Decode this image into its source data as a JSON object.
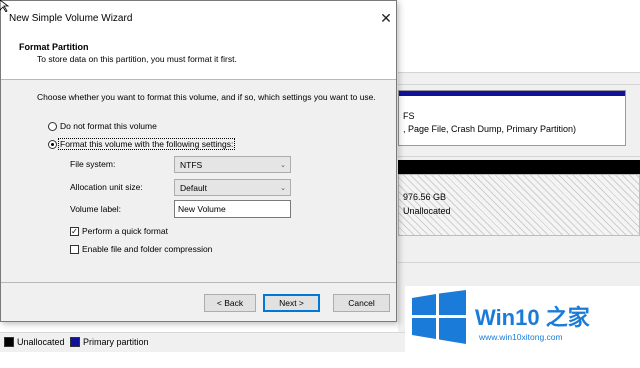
{
  "background": {
    "volume": {
      "line1": "FS",
      "line2": ", Page File, Crash Dump, Primary Partition)"
    },
    "unallocated": {
      "size": "976.56 GB",
      "label": "Unallocated"
    },
    "legend": {
      "items": [
        {
          "label": "Unallocated",
          "color": "#000000"
        },
        {
          "label": "Primary partition",
          "color": "#11119c"
        }
      ]
    }
  },
  "dialog": {
    "title": "New Simple Volume Wizard",
    "header_title": "Format Partition",
    "header_subtitle": "To store data on this partition, you must format it first.",
    "instruction": "Choose whether you want to format this volume, and if so, which settings you want to use.",
    "option_no_format": "Do not format this volume",
    "option_format": "Format this volume with the following settings:",
    "selected_option": "format",
    "file_system_label": "File system:",
    "file_system_value": "NTFS",
    "allocation_label": "Allocation unit size:",
    "allocation_value": "Default",
    "volume_label_label": "Volume label:",
    "volume_label_value": "New Volume",
    "quick_format_label": "Perform a quick format",
    "quick_format_checked": true,
    "compression_label": "Enable file and folder compression",
    "compression_checked": false,
    "buttons": {
      "back": "< Back",
      "next": "Next >",
      "cancel": "Cancel"
    }
  },
  "watermark": {
    "brand": "Win10 之家",
    "url": "www.win10xitong.com",
    "color": "#1a7cd8"
  }
}
